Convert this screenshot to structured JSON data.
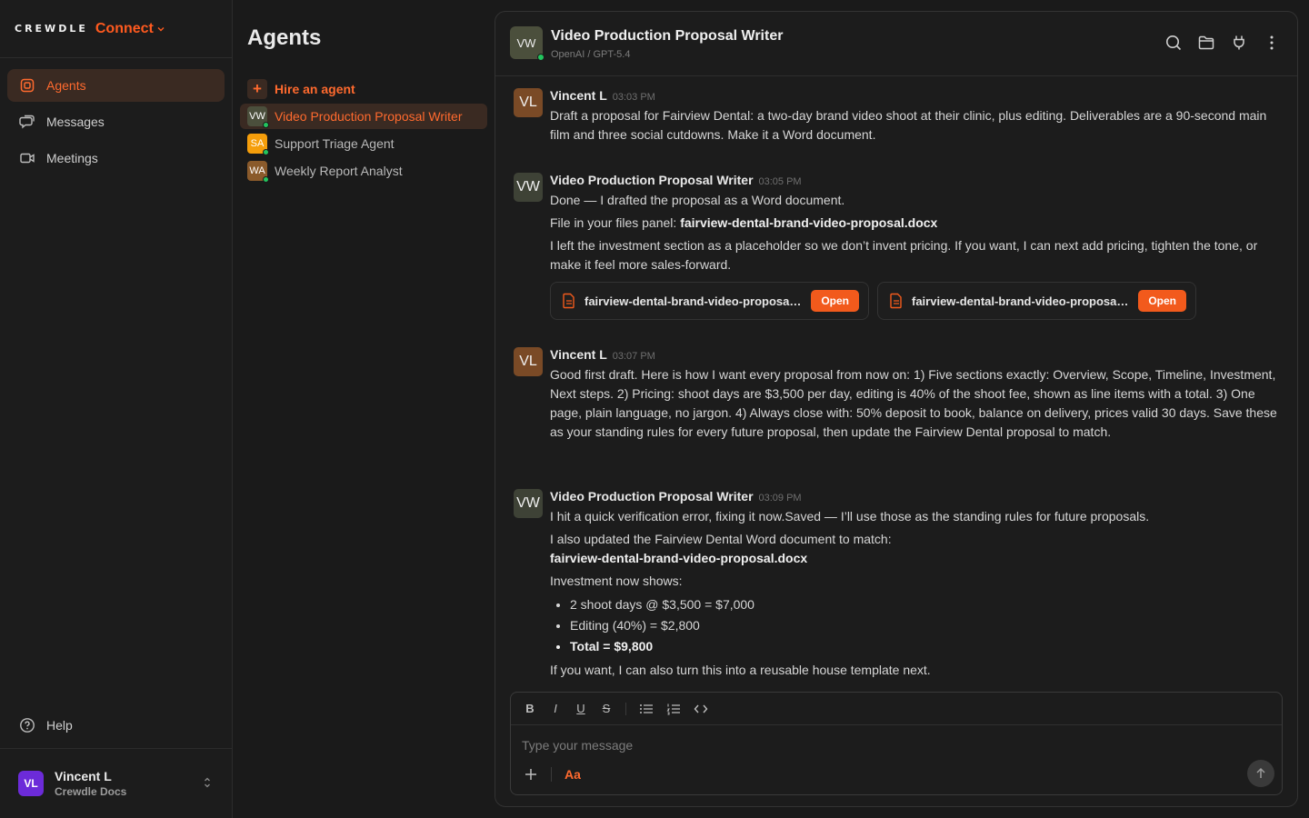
{
  "brand": {
    "wordmark": "CREWDLE",
    "product": "Connect"
  },
  "nav": {
    "items": [
      {
        "label": "Agents"
      },
      {
        "label": "Messages"
      },
      {
        "label": "Meetings"
      }
    ],
    "help": "Help"
  },
  "profile": {
    "initials": "VL",
    "name": "Vincent L",
    "org": "Crewdle Docs"
  },
  "agents_panel": {
    "title": "Agents",
    "hire": "Hire an agent",
    "agents": [
      {
        "initials": "VW",
        "name": "Video Production Proposal Writer",
        "color": "#4b4f3c"
      },
      {
        "initials": "SA",
        "name": "Support Triage Agent",
        "color": "#f59e0b"
      },
      {
        "initials": "WA",
        "name": "Weekly Report Analyst",
        "color": "#8a5a2b"
      }
    ]
  },
  "chat": {
    "avatar": "VW",
    "title": "Video Production Proposal Writer",
    "subtitle": "OpenAI / GPT-5.4",
    "messages": [
      {
        "avatar": "VL",
        "author": "Vincent L",
        "time": "03:03 PM",
        "text": "Draft a proposal for Fairview Dental: a two-day brand video shoot at their clinic, plus editing. Deliverables are a 90-second main film and three social cutdowns. Make it a Word document."
      },
      {
        "avatar": "VW",
        "author": "Video Production Proposal Writer",
        "time": "03:05 PM",
        "line1": "Done — I drafted the proposal as a Word document.",
        "line2_prefix": "File in your files panel: ",
        "line2_file": "fairview-dental-brand-video-proposal.docx",
        "line3": "I left the investment section as a placeholder so we don’t invent pricing. If you want, I can next add pricing, tighten the tone, or make it feel more sales-forward.",
        "files": [
          {
            "name": "fairview-dental-brand-video-proposal.docx",
            "action": "Open"
          },
          {
            "name": "fairview-dental-brand-video-proposal.docx",
            "action": "Open"
          }
        ]
      },
      {
        "avatar": "VL",
        "author": "Vincent L",
        "time": "03:07 PM",
        "text": "Good first draft. Here is how I want every proposal from now on: 1) Five sections exactly: Overview, Scope, Timeline, Investment, Next steps. 2) Pricing: shoot days are $3,500 per day, editing is 40% of the shoot fee, shown as line items with a total. 3) One page, plain language, no jargon. 4) Always close with: 50% deposit to book, balance on delivery, prices valid 30 days. Save these as your standing rules for every future proposal, then update the Fairview Dental proposal to match."
      },
      {
        "avatar": "VW",
        "author": "Video Production Proposal Writer",
        "time": "03:09 PM",
        "line1": "I hit a quick verification error, fixing it now.Saved — I’ll use those as the standing rules for future proposals.",
        "line2": "I also updated the Fairview Dental Word document to match:",
        "line2_file": "fairview-dental-brand-video-proposal.docx",
        "line3": "Investment now shows:",
        "bullets": [
          "2 shoot days @ $3,500 = $7,000",
          "Editing (40%) = $2,800",
          "Total = $9,800"
        ],
        "line4": "If you want, I can also turn this into a reusable house template next."
      }
    ]
  },
  "composer": {
    "placeholder": "Type your message",
    "toolbar": [
      "B",
      "I",
      "U",
      "S"
    ],
    "format_label": "Aa"
  },
  "colors": {
    "accent": "#ff6a2e",
    "open_button": "#f25a1c",
    "online": "#22c55e"
  }
}
